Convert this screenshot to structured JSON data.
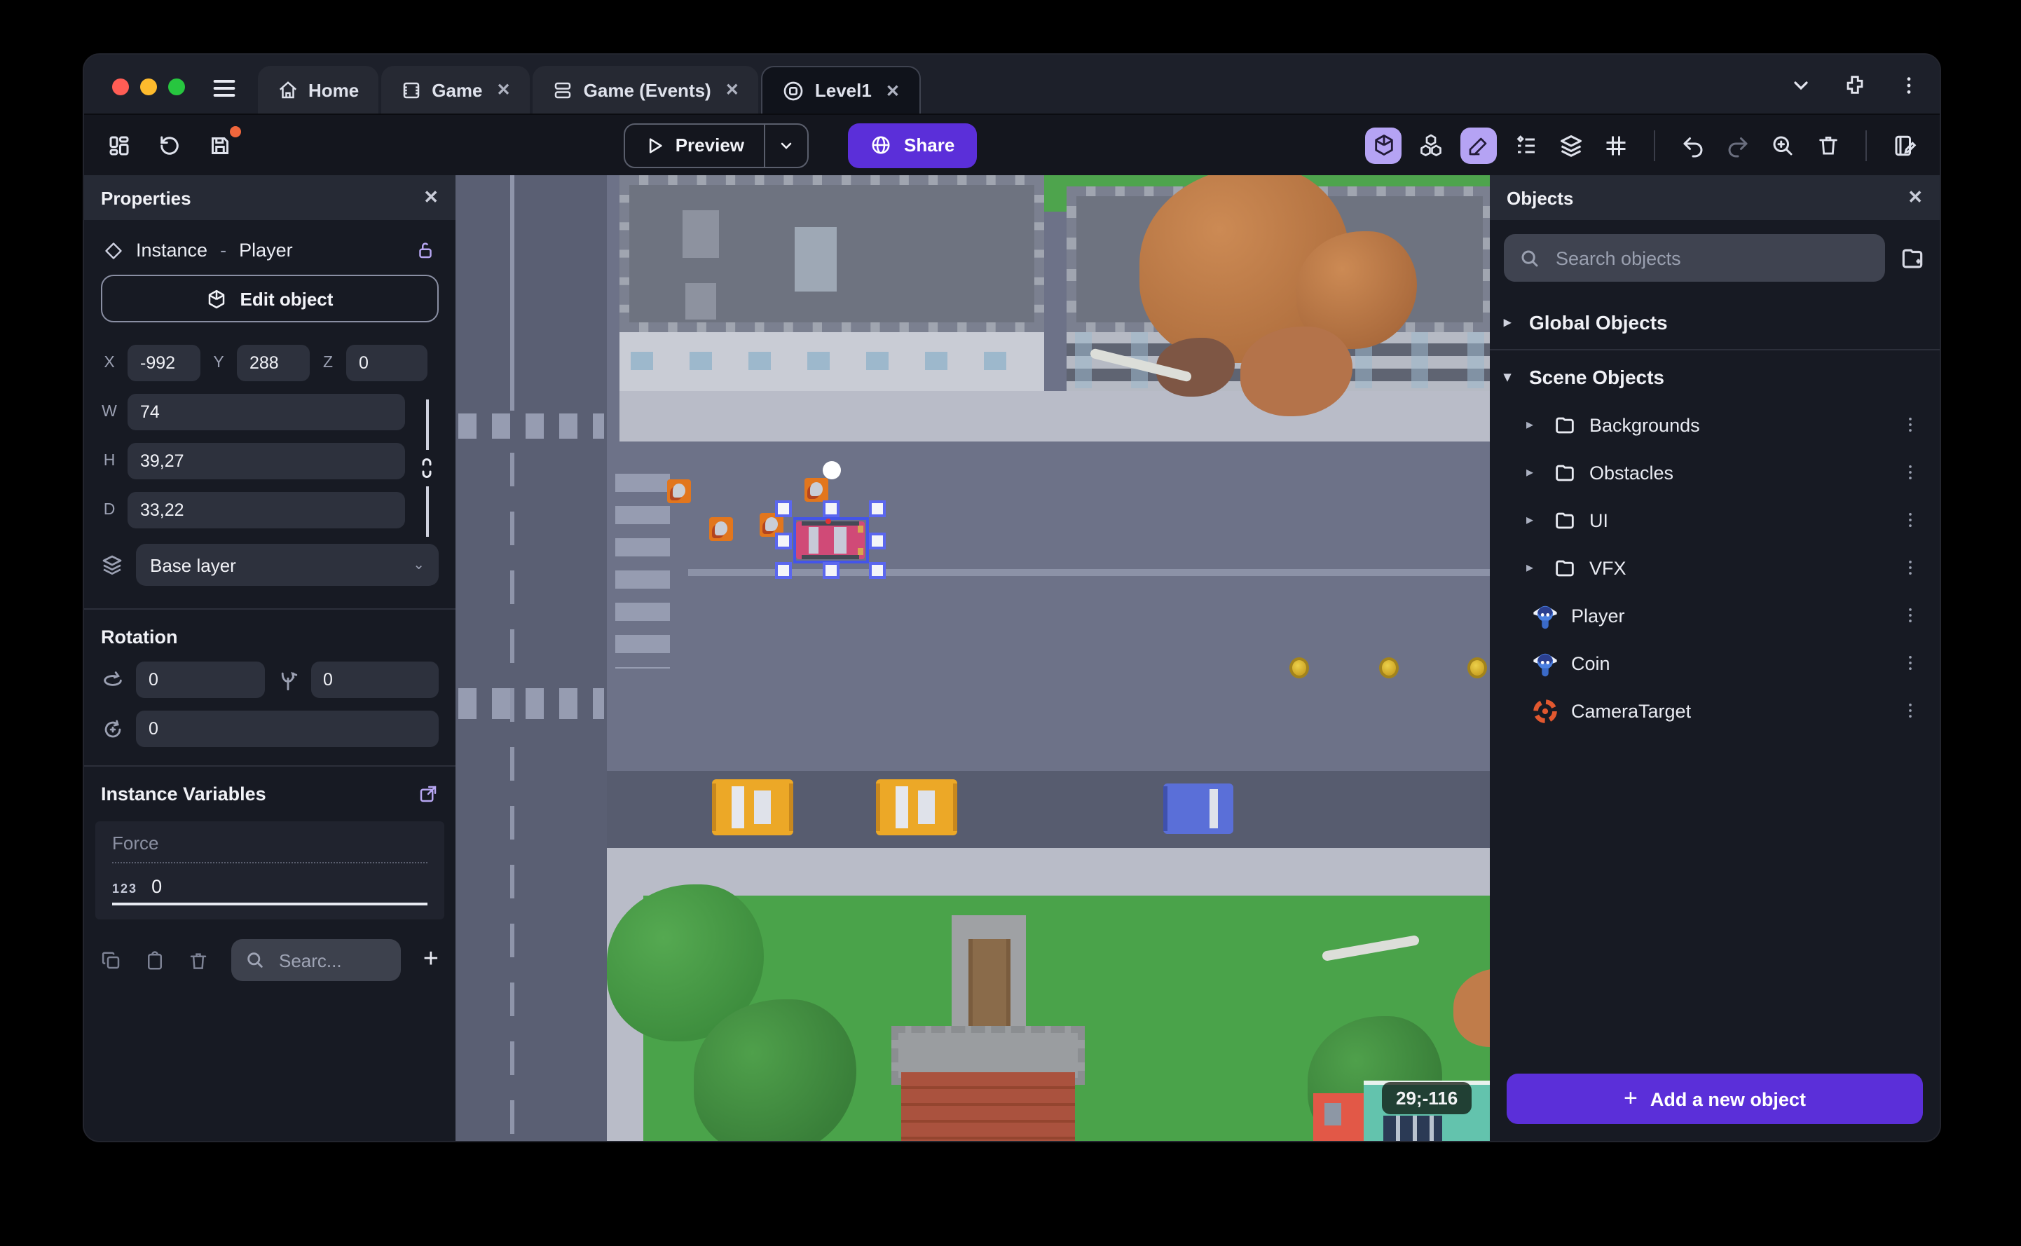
{
  "tabs": [
    {
      "label": "Home",
      "closable": false
    },
    {
      "label": "Game",
      "closable": true
    },
    {
      "label": "Game (Events)",
      "closable": true
    },
    {
      "label": "Level1",
      "closable": true,
      "active": true
    }
  ],
  "toolbar": {
    "preview_label": "Preview",
    "share_label": "Share"
  },
  "properties": {
    "title": "Properties",
    "instance_type": "Instance",
    "separator": "-",
    "instance_name": "Player",
    "edit_object_label": "Edit object",
    "x_label": "X",
    "x_value": "-992",
    "y_label": "Y",
    "y_value": "288",
    "z_label": "Z",
    "z_value": "0",
    "w_label": "W",
    "w_value": "74",
    "h_label": "H",
    "h_value": "39,27",
    "d_label": "D",
    "d_value": "33,22",
    "layer_value": "Base layer",
    "rotation_title": "Rotation",
    "rot_x": "0",
    "rot_y": "0",
    "rot_z": "0",
    "variables_title": "Instance Variables",
    "variable_name": "Force",
    "variable_type_badge": "123",
    "variable_value": "0",
    "search_placeholder": "Searc..."
  },
  "objects_panel": {
    "title": "Objects",
    "search_placeholder": "Search objects",
    "global_group": "Global Objects",
    "scene_group": "Scene Objects",
    "items": [
      {
        "label": "Backgrounds",
        "type": "folder"
      },
      {
        "label": "Obstacles",
        "type": "folder"
      },
      {
        "label": "UI",
        "type": "folder"
      },
      {
        "label": "VFX",
        "type": "folder"
      },
      {
        "label": "Player",
        "type": "sprite"
      },
      {
        "label": "Coin",
        "type": "sprite"
      },
      {
        "label": "CameraTarget",
        "type": "target"
      }
    ],
    "add_button_label": "Add a new object"
  },
  "canvas": {
    "coordinates_badge": "29;-116"
  },
  "colors": {
    "accent_purple": "#5b2fd9",
    "active_toggle_purple": "#b5a3f4",
    "selection_blue": "#5b67ee",
    "traffic_red": "#ff5d55",
    "traffic_yellow": "#febb2d",
    "traffic_green": "#27c63f",
    "grass_green": "#4aa34a",
    "road_dark": "#5a5f73",
    "plaza_gray": "#6d7288",
    "sidewalk_light": "#b9bcc8",
    "crosswalk": "#969cb1",
    "car_pink": "#d04a77",
    "car_yellow": "#eca827",
    "car_blue": "#5a6fd8",
    "coin_gold": "#cda626",
    "crate_orange": "#e2761d",
    "brick_red": "#aa523e",
    "tree_green": "#3f8e3e",
    "tree_orange": "#c07c4a",
    "notification_orange": "#f0663c"
  }
}
